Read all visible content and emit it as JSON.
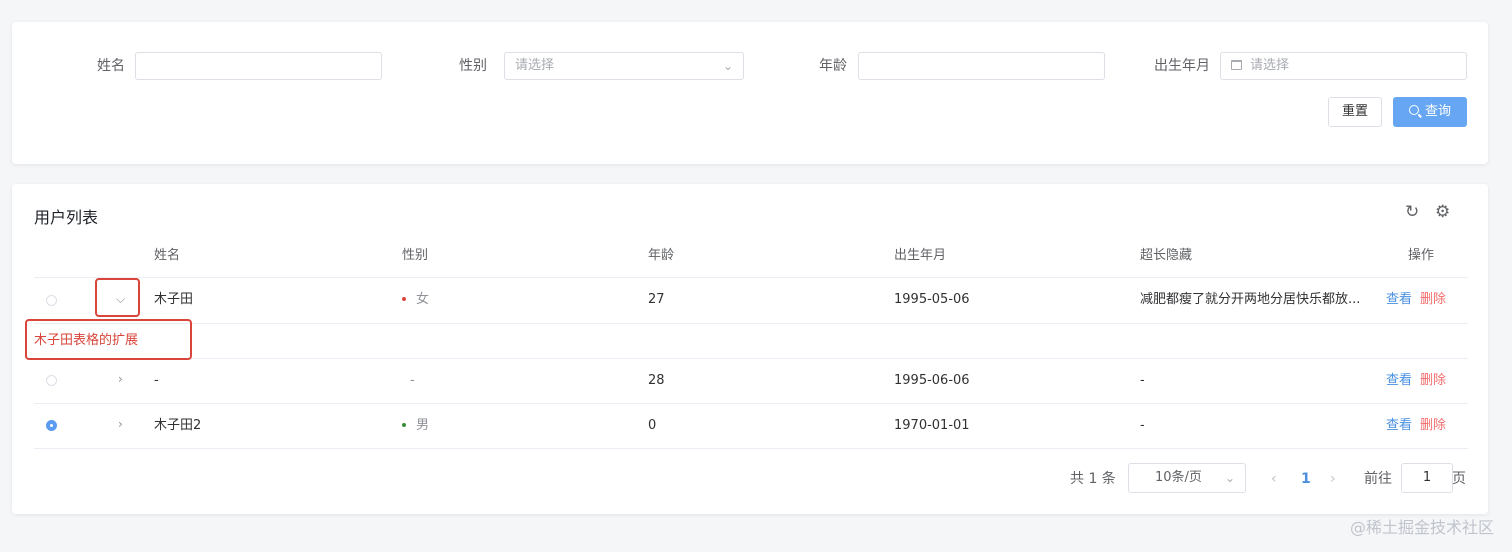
{
  "search": {
    "fields": [
      {
        "label": "姓名",
        "value": "",
        "placeholder": ""
      },
      {
        "label": "性别",
        "value": "",
        "placeholder": "请选择"
      },
      {
        "label": "年龄",
        "value": "",
        "placeholder": ""
      },
      {
        "label": "出生年月",
        "value": "",
        "placeholder": "请选择"
      }
    ],
    "reset_label": "重置",
    "query_label": "查询"
  },
  "table": {
    "title": "用户列表",
    "columns": [
      "姓名",
      "性别",
      "年龄",
      "出生年月",
      "超长隐藏",
      "操作"
    ],
    "rows": [
      {
        "selected": false,
        "expanded": true,
        "name": "木子田",
        "gender": "女",
        "gender_color": "#d9453a",
        "age": "27",
        "birth": "1995-05-06",
        "long_text": "减肥都瘦了就分开两地分居快乐都放...",
        "view": "查看",
        "delete": "删除"
      },
      {
        "selected": false,
        "expanded": false,
        "name": "-",
        "gender": "-",
        "gender_color": "",
        "age": "28",
        "birth": "1995-06-06",
        "long_text": "-",
        "view": "查看",
        "delete": "删除"
      },
      {
        "selected": true,
        "expanded": false,
        "name": "木子田2",
        "gender": "男",
        "gender_color": "#3a8e3a",
        "age": "0",
        "birth": "1970-01-01",
        "long_text": "-",
        "view": "查看",
        "delete": "删除"
      }
    ],
    "expanded_content": "木子田表格的扩展",
    "highlight_color": "#d9453a"
  },
  "pagination": {
    "total_text": "共 1 条",
    "page_size": "10条/页",
    "current_page": "1",
    "goto_prefix": "前往",
    "goto_value": "1",
    "goto_suffix": "页"
  },
  "watermark": "@稀土掘金技术社区",
  "colors": {
    "primary": "#66a6f2",
    "link": "#4a90e2",
    "danger": "#f56c6c"
  }
}
